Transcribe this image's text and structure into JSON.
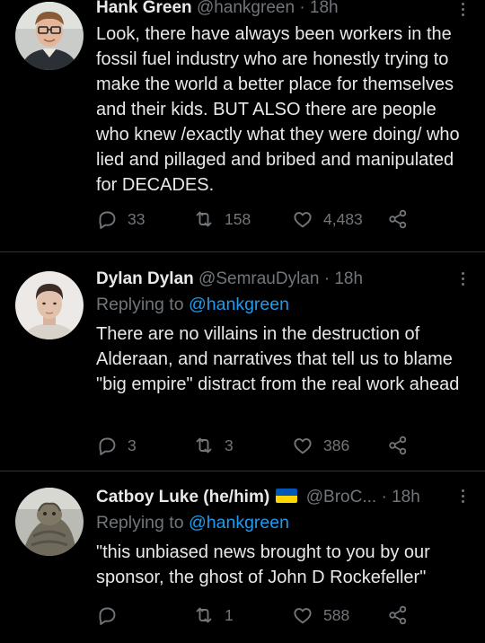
{
  "tweets": [
    {
      "author_name": "Hank Green",
      "author_handle": "@hankgreen",
      "separator": "·",
      "time": "18h",
      "replying_label": "",
      "replying_handle": "",
      "body": "Look, there have always been workers in the fossil fuel industry who are honestly trying to make the world a better place for themselves and their kids. BUT ALSO there are people who knew /exactly what they were doing/ who lied and pillaged and bribed and manipulated for DECADES.",
      "replies": "33",
      "retweets": "158",
      "likes": "4,483"
    },
    {
      "author_name": "Dylan Dylan",
      "author_handle": "@SemrauDylan",
      "separator": "·",
      "time": "18h",
      "replying_label": "Replying to",
      "replying_handle": "@hankgreen",
      "body": "There are no villains in the destruction of Alderaan, and narratives that tell us to blame \"big empire\" distract from the real work ahead",
      "replies": "3",
      "retweets": "3",
      "likes": "386"
    },
    {
      "author_name": "Catboy Luke (he/him)",
      "author_handle": "@BroC...",
      "separator": "·",
      "time": "18h",
      "replying_label": "Replying to",
      "replying_handle": "@hankgreen",
      "body": "\"this unbiased news brought to you by our sponsor, the ghost of John D Rockefeller\"",
      "replies": "",
      "retweets": "1",
      "likes": "588"
    }
  ],
  "icons": {
    "reply": "reply-icon",
    "retweet": "retweet-icon",
    "like": "heart-icon",
    "share": "share-icon",
    "more": "more-icon",
    "flag": "ukraine-flag-icon"
  },
  "colors": {
    "background": "#000000",
    "text": "#e7e9ea",
    "muted": "#71767b",
    "link": "#1d9bf0",
    "divider": "#2f3336"
  }
}
